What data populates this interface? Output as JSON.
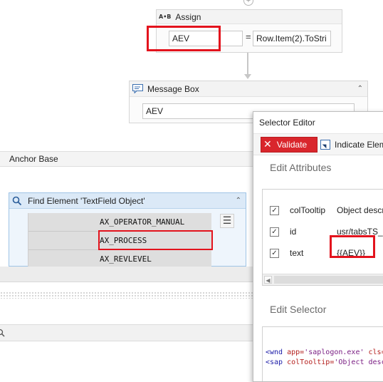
{
  "assign": {
    "title": "Assign",
    "icon": "A•B",
    "to_value": "AEV",
    "value_expr": "Row.Item(2).ToStri",
    "equals": "="
  },
  "message_box": {
    "title": "Message Box",
    "text_value": "AEV"
  },
  "anchor_base": {
    "title": "Anchor Base"
  },
  "find_element": {
    "title": "Find Element 'TextField Object'",
    "rows": [
      "AX_OPERATOR_MANUAL",
      "AX_PROCESS",
      "AX_REVLEVEL"
    ]
  },
  "selector_editor": {
    "title": "Selector Editor",
    "validate_label": "Validate",
    "indicate_label": "Indicate Eleme",
    "edit_attributes_label": "Edit Attributes",
    "attributes": [
      {
        "name": "colTooltip",
        "value": "Object descr",
        "checked": true
      },
      {
        "name": "id",
        "value": "usr/tabsTS_C",
        "checked": true
      },
      {
        "name": "text",
        "value": "{{AEV}}",
        "checked": true
      }
    ],
    "edit_selector_label": "Edit Selector",
    "selector_lines": [
      {
        "tag": "<wnd",
        "attr1": " app=",
        "val1": "'saplogon.exe'",
        "attr2": " cls=",
        "val2": ""
      },
      {
        "tag": "<sap",
        "attr1": " colTooltip=",
        "val1": "'Object desc",
        "attr2": "",
        "val2": ""
      }
    ]
  },
  "colors": {
    "highlight_red": "#e3131d",
    "validate_red": "#d9262c",
    "find_header_blue": "#dbe9f7"
  }
}
